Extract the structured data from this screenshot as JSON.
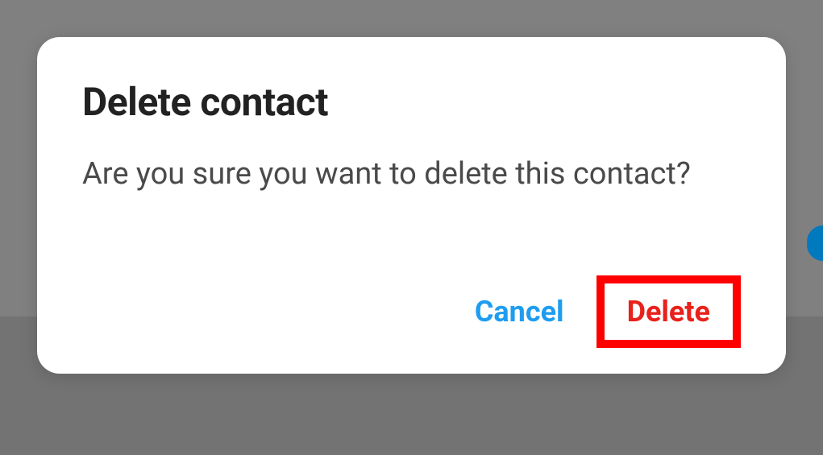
{
  "dialog": {
    "title": "Delete contact",
    "message": "Are you sure you want to delete this contact?",
    "actions": {
      "cancel_label": "Cancel",
      "delete_label": "Delete"
    }
  },
  "colors": {
    "cancel": "#1e9df0",
    "delete": "#e8211a",
    "highlight": "#ff0000"
  }
}
